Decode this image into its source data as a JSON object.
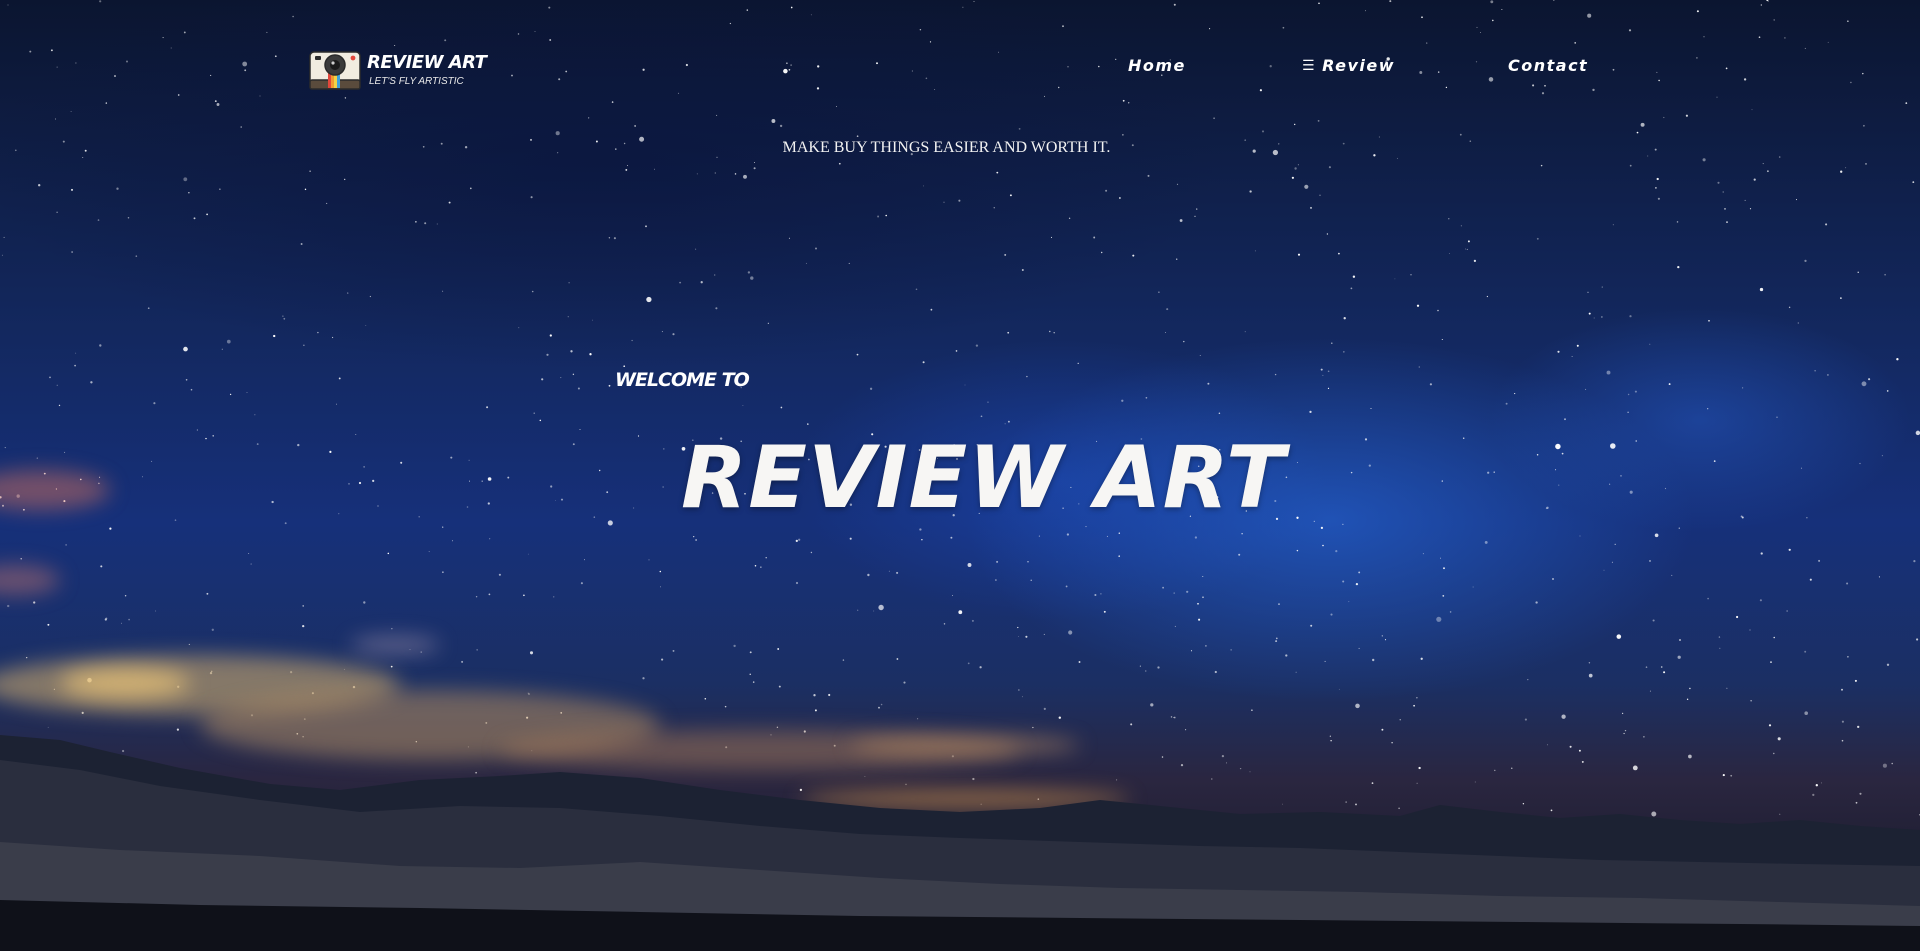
{
  "brand": {
    "name": "REVIEW ART",
    "tagline": "LET'S FLY ARTISTIC",
    "logo_icon": "instant-camera-icon"
  },
  "nav": {
    "items": [
      {
        "label": "Home",
        "icon": ""
      },
      {
        "label": "Review",
        "icon": "menu-icon"
      },
      {
        "label": "Contact",
        "icon": ""
      }
    ]
  },
  "header": {
    "subtitle": "MAKE BUY THINGS EASIER AND WORTH IT."
  },
  "hero": {
    "welcome": "WELCOME TO",
    "title": "REVIEW ART"
  },
  "colors": {
    "sky_top": "#0b1530",
    "sky_mid": "#16307a",
    "text": "#ffffff"
  }
}
